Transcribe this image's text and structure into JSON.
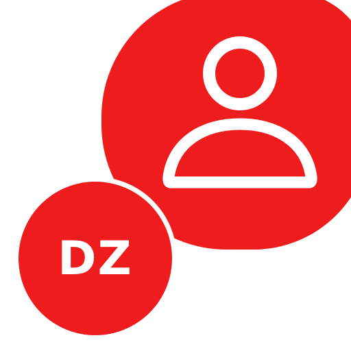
{
  "app_icon": {
    "accent_color": "#ee1c1c",
    "foreground_color": "#ffffff",
    "profile_icon": "user-profile-icon",
    "badge_text": "DZ"
  }
}
